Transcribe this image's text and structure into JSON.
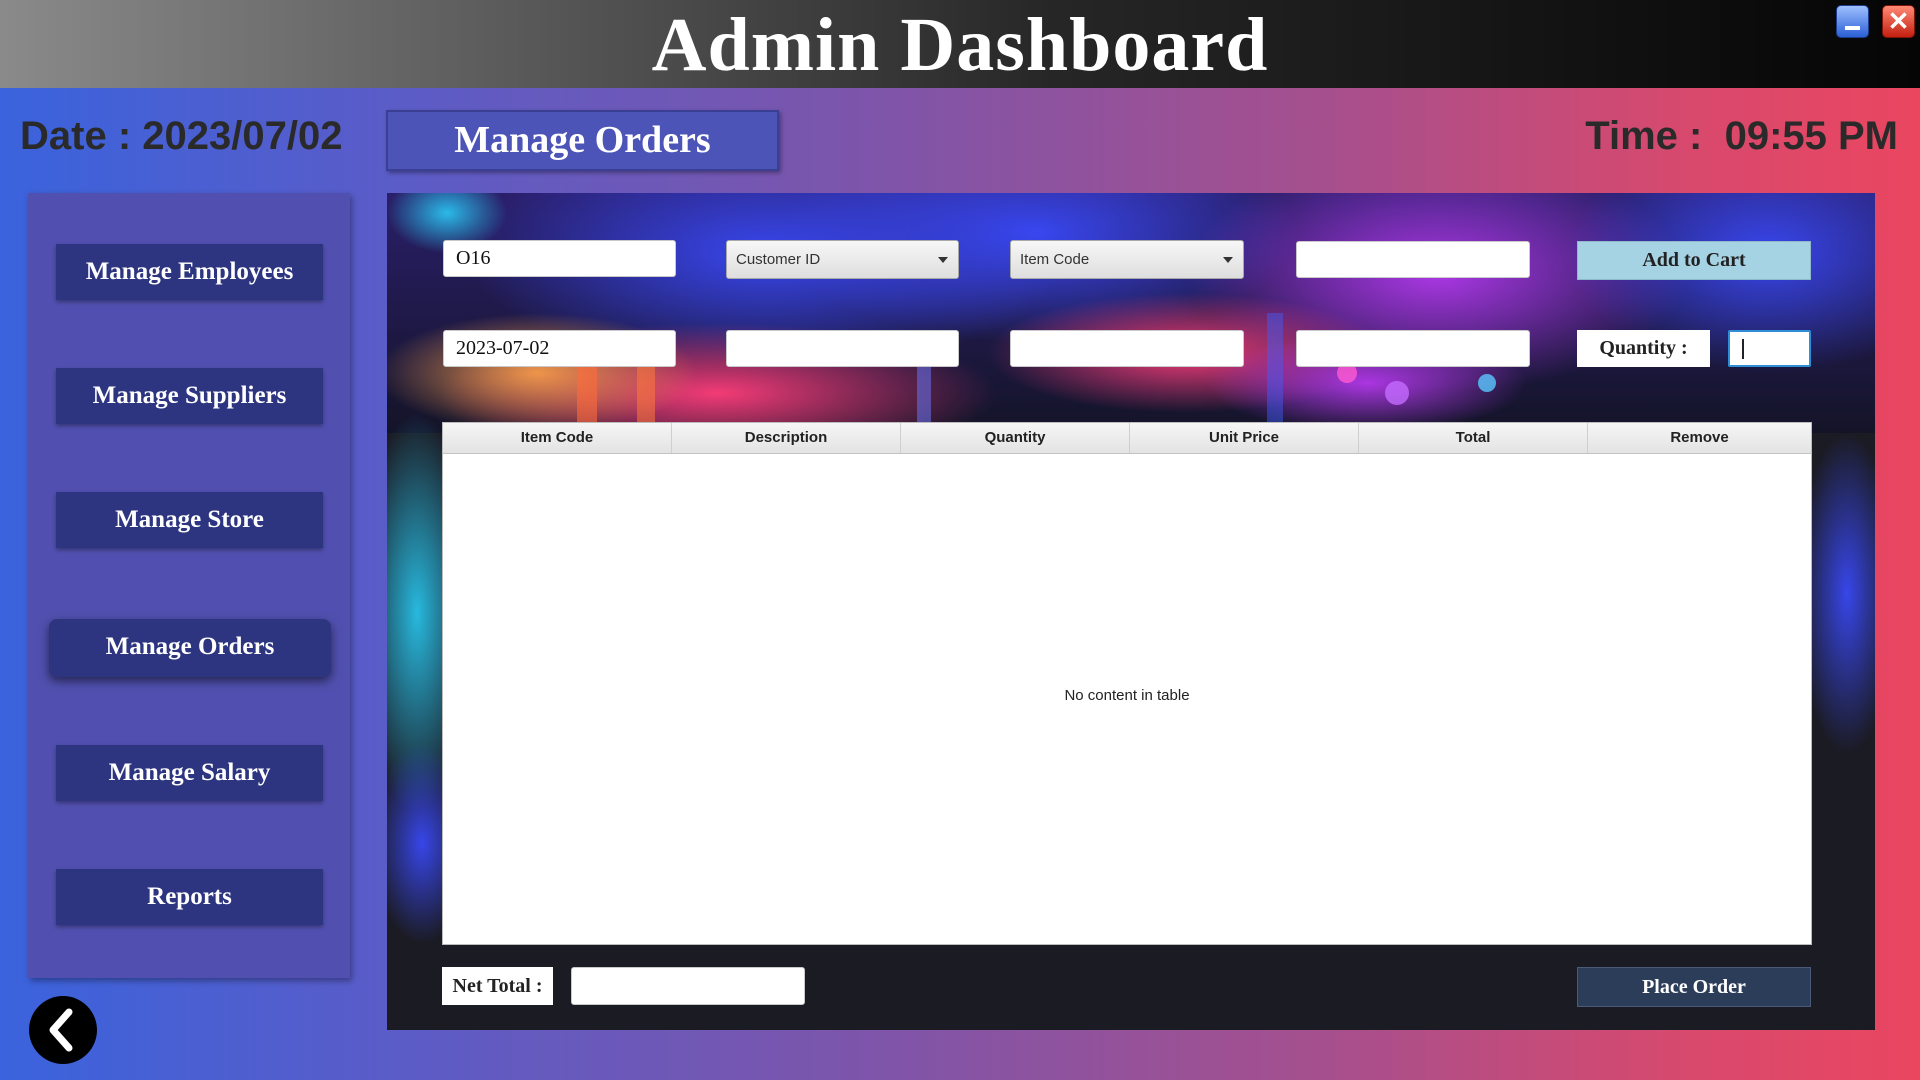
{
  "window": {
    "title": "Admin Dashboard",
    "minimize_icon": "minimize-icon",
    "close_icon": "close-icon",
    "close_glyph": "✕"
  },
  "header": {
    "date_text": "Date : 2023/07/02",
    "time_text": "Time :  09:55 PM",
    "section_title": "Manage Orders"
  },
  "sidebar": {
    "items": [
      {
        "label": "Manage Employees",
        "active": false
      },
      {
        "label": "Manage Suppliers",
        "active": false
      },
      {
        "label": "Manage Store",
        "active": false
      },
      {
        "label": "Manage Orders",
        "active": true
      },
      {
        "label": "Manage Salary",
        "active": false
      },
      {
        "label": "Reports",
        "active": false
      }
    ],
    "back_icon": "chevron-left-icon"
  },
  "form": {
    "order_id_value": "O16",
    "customer_combo_placeholder": "Customer ID",
    "item_combo_placeholder": "Item Code",
    "field_row1_col4_value": "",
    "add_to_cart_label": "Add to Cart",
    "order_date_value": "2023-07-02",
    "field_row2_col2_value": "",
    "field_row2_col3_value": "",
    "field_row2_col4_value": "",
    "quantity_label": "Quantity :",
    "quantity_value": ""
  },
  "table": {
    "columns": [
      "Item Code",
      "Description",
      "Quantity",
      "Unit Price",
      "Total",
      "Remove"
    ],
    "rows": [],
    "empty_message": "No content in table"
  },
  "footer": {
    "net_total_label": "Net Total :",
    "net_total_value": "",
    "place_order_label": "Place Order"
  },
  "colors": {
    "accent_nav": "#2d3580",
    "add_to_cart": "#a6d3e4",
    "place_order": "#2c3d5a"
  }
}
